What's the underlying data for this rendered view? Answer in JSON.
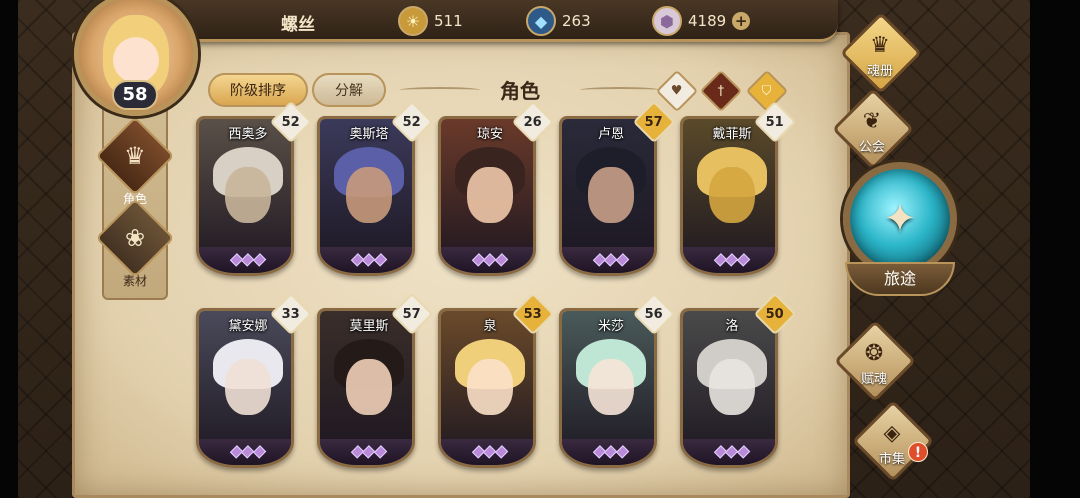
{
  "player": {
    "name": "螺丝",
    "level": "58"
  },
  "currencies": [
    {
      "icon": "gold-coin-icon",
      "value": "511"
    },
    {
      "icon": "blue-crystal-icon",
      "value": "263"
    },
    {
      "icon": "prism-gem-icon",
      "value": "4189",
      "plus": "+"
    }
  ],
  "side_menu": [
    {
      "icon": "character-mask-icon",
      "label": "角色",
      "active": true
    },
    {
      "icon": "material-wolf-icon",
      "label": "素材",
      "active": false
    }
  ],
  "tabs": [
    {
      "label": "阶级排序",
      "active": true
    },
    {
      "label": "分解",
      "active": false
    }
  ],
  "panel_title": "角色",
  "filters": [
    {
      "icon": "heart-icon",
      "glyph": "♥"
    },
    {
      "icon": "sword-icon",
      "glyph": "†"
    },
    {
      "icon": "shield-icon",
      "glyph": "⛉"
    }
  ],
  "characters": [
    {
      "name": "西奥多",
      "level": "52",
      "badge": "white",
      "colors": [
        "#5a5048",
        "#c9b59a",
        "#d8d0c4"
      ]
    },
    {
      "name": "奥斯塔",
      "level": "52",
      "badge": "white",
      "colors": [
        "#3b3a5a",
        "#c79a7a",
        "#5a5fa8"
      ]
    },
    {
      "name": "琼安",
      "level": "26",
      "badge": "white",
      "colors": [
        "#6a3a2a",
        "#f0c8a8",
        "#3a2420"
      ]
    },
    {
      "name": "卢恩",
      "level": "57",
      "badge": "gold",
      "colors": [
        "#2a2a3a",
        "#c8a088",
        "#1e1e2a"
      ]
    },
    {
      "name": "戴菲斯",
      "level": "51",
      "badge": "white",
      "colors": [
        "#5a4a2a",
        "#d4a640",
        "#e6c060"
      ]
    },
    {
      "name": "黛安娜",
      "level": "33",
      "badge": "white",
      "colors": [
        "#4a4a5a",
        "#f0e0d4",
        "#e8e8ee"
      ]
    },
    {
      "name": "莫里斯",
      "level": "57",
      "badge": "white",
      "colors": [
        "#3a2e2a",
        "#f0cfb8",
        "#241a18"
      ]
    },
    {
      "name": "泉",
      "level": "53",
      "badge": "gold",
      "colors": [
        "#6a4a2a",
        "#fbe0c8",
        "#f0cf7a"
      ]
    },
    {
      "name": "米莎",
      "level": "56",
      "badge": "white",
      "colors": [
        "#4a5a5a",
        "#f6e4d8",
        "#bfe6d4"
      ]
    },
    {
      "name": "洛",
      "level": "50",
      "badge": "gold",
      "colors": [
        "#4a4a4a",
        "#e8e4e0",
        "#d0ccc8"
      ]
    }
  ],
  "right_nav": [
    {
      "icon": "soul-book-icon",
      "glyph": "♛",
      "label": "魂册",
      "active": true
    },
    {
      "icon": "guild-icon",
      "glyph": "❦",
      "label": "公会",
      "active": false
    },
    {
      "icon": "soul-gift-icon",
      "glyph": "❂",
      "label": "赋魂",
      "active": false
    },
    {
      "icon": "market-icon",
      "glyph": "◈",
      "label": "市集",
      "active": false,
      "alert": "!"
    }
  ],
  "journey": {
    "icon": "compass-crest-icon",
    "glyph": "✦",
    "label": "旅途"
  }
}
